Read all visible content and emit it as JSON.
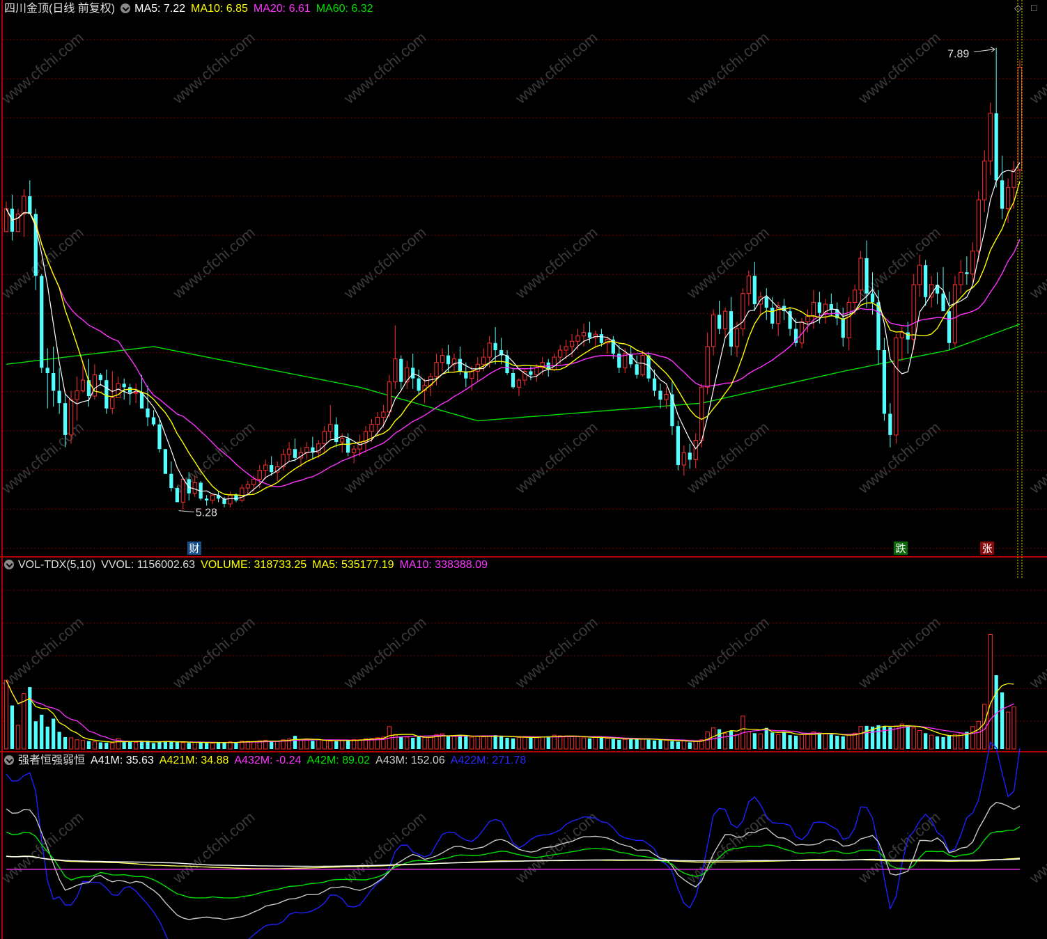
{
  "main_header": {
    "title": "四川金顶(日线 前复权)",
    "ma5": "MA5: 7.22",
    "ma10": "MA10: 6.85",
    "ma20": "MA20: 6.61",
    "ma60": "MA60: 6.32"
  },
  "vol_header": {
    "name": "VOL-TDX(5,10)",
    "vvol": "VVOL: 1156002.63",
    "volume": "VOLUME: 318733.25",
    "ma5": "MA5: 535177.19",
    "ma10": "MA10: 338388.09"
  },
  "ind_header": {
    "name": "强者恒强弱恒",
    "a41m": "A41M: 35.63",
    "a421m": "A421M: 34.88",
    "a432m": "A432M: -0.24",
    "a42m": "A42M: 89.02",
    "a43m": "A43M: 152.06",
    "a422m": "A422M: 271.78"
  },
  "annotations": {
    "high": "7.89",
    "low": "5.28",
    "cai": "财",
    "die": "跌",
    "zhang": "张"
  },
  "colors": {
    "up": "#ff3030",
    "down": "#54ffff",
    "ma5": "#ffffff",
    "ma10": "#ffff00",
    "ma20": "#ff33ff",
    "ma60": "#00e000",
    "grid": "#7a0000",
    "a422m": "#2020ff",
    "a43m": "#c8c8c8",
    "a42m": "#00e000",
    "a421m": "#ffff66",
    "a41m": "#ffffff",
    "a432m": "#ff33ff"
  },
  "watermark": "www.cfchi.com",
  "chart_data": [
    {
      "type": "candlestick",
      "title": "四川金顶(日线 前复权)",
      "ylim": [
        5.05,
        8.05
      ],
      "max_price": 7.89,
      "min_price": 5.28,
      "ohlc": [
        [
          6.85,
          7.02,
          6.85,
          6.98
        ],
        [
          6.98,
          7.06,
          6.8,
          6.85
        ],
        [
          6.85,
          6.98,
          6.85,
          6.95
        ],
        [
          6.95,
          7.09,
          6.82,
          7.05
        ],
        [
          7.05,
          7.14,
          6.95,
          6.95
        ],
        [
          6.95,
          6.98,
          6.52,
          6.6
        ],
        [
          6.6,
          6.61,
          6.05,
          6.08
        ],
        [
          6.08,
          6.19,
          5.85,
          6.05
        ],
        [
          6.05,
          6.2,
          5.86,
          5.95
        ],
        [
          5.95,
          6.08,
          5.82,
          5.88
        ],
        [
          5.88,
          5.93,
          5.63,
          5.7
        ],
        [
          5.7,
          5.95,
          5.65,
          5.9
        ],
        [
          5.9,
          6.03,
          5.78,
          5.95
        ],
        [
          5.95,
          6.12,
          5.94,
          6.01
        ],
        [
          6.01,
          6.13,
          5.86,
          5.92
        ],
        [
          5.92,
          6.1,
          5.9,
          6.04
        ],
        [
          6.04,
          6.05,
          5.98,
          6.01
        ],
        [
          6.01,
          6.07,
          5.82,
          5.85
        ],
        [
          5.85,
          6.06,
          5.82,
          5.91
        ],
        [
          5.91,
          6.03,
          5.94,
          5.99
        ],
        [
          5.99,
          6.02,
          5.9,
          5.97
        ],
        [
          5.97,
          5.99,
          5.87,
          5.94
        ],
        [
          5.94,
          5.99,
          5.88,
          5.94
        ],
        [
          5.94,
          6.04,
          5.85,
          5.85
        ],
        [
          5.85,
          5.98,
          5.75,
          5.8
        ],
        [
          5.8,
          5.84,
          5.75,
          5.76
        ],
        [
          5.76,
          5.79,
          5.6,
          5.62
        ],
        [
          5.62,
          5.61,
          5.5,
          5.48
        ],
        [
          5.48,
          5.55,
          5.38,
          5.4
        ],
        [
          5.4,
          5.41,
          5.32,
          5.32
        ],
        [
          5.32,
          5.46,
          5.28,
          5.45
        ],
        [
          5.45,
          5.49,
          5.33,
          5.37
        ],
        [
          5.37,
          5.47,
          5.35,
          5.43
        ],
        [
          5.43,
          5.44,
          5.33,
          5.34
        ],
        [
          5.34,
          5.36,
          5.3,
          5.33
        ],
        [
          5.33,
          5.36,
          5.31,
          5.36
        ],
        [
          5.36,
          5.38,
          5.32,
          5.34
        ],
        [
          5.34,
          5.35,
          5.29,
          5.31
        ],
        [
          5.31,
          5.38,
          5.29,
          5.36
        ],
        [
          5.36,
          5.37,
          5.32,
          5.33
        ],
        [
          5.33,
          5.42,
          5.32,
          5.4
        ],
        [
          5.4,
          5.44,
          5.36,
          5.42
        ],
        [
          5.42,
          5.47,
          5.38,
          5.45
        ],
        [
          5.45,
          5.53,
          5.4,
          5.5
        ],
        [
          5.5,
          5.56,
          5.45,
          5.53
        ],
        [
          5.53,
          5.58,
          5.47,
          5.49
        ],
        [
          5.49,
          5.55,
          5.44,
          5.52
        ],
        [
          5.52,
          5.62,
          5.5,
          5.59
        ],
        [
          5.59,
          5.66,
          5.55,
          5.62
        ],
        [
          5.62,
          5.68,
          5.55,
          5.57
        ],
        [
          5.57,
          5.63,
          5.52,
          5.6
        ],
        [
          5.6,
          5.66,
          5.56,
          5.63
        ],
        [
          5.63,
          5.69,
          5.56,
          5.6
        ],
        [
          5.6,
          5.67,
          5.57,
          5.65
        ],
        [
          5.65,
          5.75,
          5.6,
          5.72
        ],
        [
          5.72,
          5.87,
          5.68,
          5.76
        ],
        [
          5.76,
          5.8,
          5.63,
          5.66
        ],
        [
          5.66,
          5.71,
          5.6,
          5.68
        ],
        [
          5.68,
          5.71,
          5.58,
          5.6
        ],
        [
          5.6,
          5.64,
          5.54,
          5.62
        ],
        [
          5.62,
          5.7,
          5.58,
          5.66
        ],
        [
          5.66,
          5.75,
          5.6,
          5.72
        ],
        [
          5.72,
          5.79,
          5.66,
          5.76
        ],
        [
          5.76,
          5.83,
          5.7,
          5.8
        ],
        [
          5.8,
          5.87,
          5.74,
          5.83
        ],
        [
          5.83,
          6.04,
          5.8,
          6.0
        ],
        [
          6.0,
          6.32,
          5.96,
          6.13
        ],
        [
          6.13,
          6.15,
          5.96,
          6.0
        ],
        [
          6.0,
          6.12,
          5.96,
          6.08
        ],
        [
          6.08,
          6.16,
          5.96,
          6.02
        ],
        [
          6.02,
          6.07,
          5.93,
          5.95
        ],
        [
          5.95,
          6.02,
          5.88,
          5.98
        ],
        [
          5.98,
          6.05,
          5.92,
          6.03
        ],
        [
          6.03,
          6.16,
          5.98,
          6.11
        ],
        [
          6.11,
          6.19,
          6.06,
          6.15
        ],
        [
          6.15,
          6.21,
          6.05,
          6.1
        ],
        [
          6.1,
          6.16,
          6.06,
          6.13
        ],
        [
          6.13,
          6.2,
          6.04,
          6.06
        ],
        [
          6.06,
          6.11,
          5.97,
          6.02
        ],
        [
          6.02,
          6.09,
          5.95,
          6.06
        ],
        [
          6.06,
          6.14,
          6.0,
          6.1
        ],
        [
          6.1,
          6.19,
          6.06,
          6.14
        ],
        [
          6.14,
          6.26,
          6.08,
          6.22
        ],
        [
          6.22,
          6.31,
          6.1,
          6.18
        ],
        [
          6.18,
          6.25,
          6.1,
          6.15
        ],
        [
          6.15,
          6.18,
          6.04,
          6.05
        ],
        [
          6.05,
          6.08,
          5.96,
          5.97
        ],
        [
          5.97,
          6.02,
          5.92,
          6.01
        ],
        [
          6.01,
          6.07,
          5.98,
          6.06
        ],
        [
          6.06,
          6.09,
          6.01,
          6.04
        ],
        [
          6.04,
          6.1,
          6.0,
          6.08
        ],
        [
          6.08,
          6.14,
          6.04,
          6.11
        ],
        [
          6.11,
          6.13,
          6.03,
          6.07
        ],
        [
          6.07,
          6.16,
          6.06,
          6.14
        ],
        [
          6.14,
          6.21,
          6.1,
          6.18
        ],
        [
          6.18,
          6.24,
          6.13,
          6.2
        ],
        [
          6.2,
          6.27,
          6.14,
          6.23
        ],
        [
          6.23,
          6.3,
          6.18,
          6.26
        ],
        [
          6.26,
          6.33,
          6.2,
          6.28
        ],
        [
          6.28,
          6.34,
          6.22,
          6.25
        ],
        [
          6.25,
          6.29,
          6.19,
          6.27
        ],
        [
          6.27,
          6.3,
          6.2,
          6.22
        ],
        [
          6.22,
          6.26,
          6.16,
          6.24
        ],
        [
          6.24,
          6.26,
          6.13,
          6.16
        ],
        [
          6.16,
          6.21,
          6.05,
          6.08
        ],
        [
          6.08,
          6.19,
          6.05,
          6.16
        ],
        [
          6.16,
          6.2,
          6.08,
          6.1
        ],
        [
          6.1,
          6.15,
          6.02,
          6.04
        ],
        [
          6.04,
          6.18,
          6.03,
          6.15
        ],
        [
          6.15,
          6.17,
          6.0,
          6.02
        ],
        [
          6.02,
          6.07,
          5.92,
          5.95
        ],
        [
          5.95,
          5.99,
          5.85,
          5.9
        ],
        [
          5.9,
          5.97,
          5.85,
          5.93
        ],
        [
          5.93,
          6.0,
          5.7,
          5.75
        ],
        [
          5.75,
          5.78,
          5.5,
          5.53
        ],
        [
          5.53,
          5.64,
          5.47,
          5.6
        ],
        [
          5.6,
          5.65,
          5.51,
          5.56
        ],
        [
          5.56,
          5.71,
          5.51,
          5.67
        ],
        [
          5.67,
          5.99,
          5.63,
          5.97
        ],
        [
          5.97,
          6.28,
          5.93,
          6.2
        ],
        [
          6.2,
          6.41,
          6.15,
          6.38
        ],
        [
          6.38,
          6.46,
          6.27,
          6.3
        ],
        [
          6.3,
          6.42,
          6.25,
          6.4
        ],
        [
          6.4,
          6.48,
          6.15,
          6.2
        ],
        [
          6.2,
          6.34,
          6.14,
          6.3
        ],
        [
          6.3,
          6.53,
          6.26,
          6.5
        ],
        [
          6.5,
          6.63,
          6.43,
          6.6
        ],
        [
          6.6,
          6.68,
          6.4,
          6.44
        ],
        [
          6.44,
          6.51,
          6.38,
          6.48
        ],
        [
          6.48,
          6.53,
          6.35,
          6.42
        ],
        [
          6.42,
          6.48,
          6.3,
          6.33
        ],
        [
          6.33,
          6.45,
          6.26,
          6.43
        ],
        [
          6.43,
          6.47,
          6.35,
          6.4
        ],
        [
          6.4,
          6.42,
          6.26,
          6.3
        ],
        [
          6.3,
          6.36,
          6.2,
          6.22
        ],
        [
          6.22,
          6.36,
          6.19,
          6.34
        ],
        [
          6.34,
          6.41,
          6.28,
          6.37
        ],
        [
          6.37,
          6.52,
          6.3,
          6.45
        ],
        [
          6.45,
          6.51,
          6.33,
          6.39
        ],
        [
          6.39,
          6.47,
          6.33,
          6.44
        ],
        [
          6.44,
          6.5,
          6.37,
          6.41
        ],
        [
          6.41,
          6.45,
          6.32,
          6.36
        ],
        [
          6.36,
          6.42,
          6.2,
          6.25
        ],
        [
          6.25,
          6.48,
          6.18,
          6.45
        ],
        [
          6.45,
          6.55,
          6.38,
          6.52
        ],
        [
          6.52,
          6.74,
          6.46,
          6.7
        ],
        [
          6.7,
          6.8,
          6.42,
          6.5
        ],
        [
          6.5,
          6.62,
          6.38,
          6.45
        ],
        [
          6.45,
          6.52,
          6.1,
          6.18
        ],
        [
          6.18,
          6.25,
          5.78,
          5.82
        ],
        [
          5.82,
          5.88,
          5.63,
          5.7
        ],
        [
          5.7,
          6.27,
          5.65,
          6.25
        ],
        [
          6.25,
          6.31,
          6.12,
          6.28
        ],
        [
          6.28,
          6.34,
          6.16,
          6.24
        ],
        [
          6.24,
          6.61,
          6.18,
          6.55
        ],
        [
          6.55,
          6.72,
          6.48,
          6.66
        ],
        [
          6.66,
          6.69,
          6.43,
          6.48
        ],
        [
          6.48,
          6.6,
          6.42,
          6.55
        ],
        [
          6.55,
          6.62,
          6.44,
          6.5
        ],
        [
          6.5,
          6.65,
          6.45,
          6.4
        ],
        [
          6.4,
          6.51,
          6.18,
          6.22
        ],
        [
          6.22,
          6.6,
          6.2,
          6.55
        ],
        [
          6.55,
          6.69,
          6.5,
          6.62
        ],
        [
          6.62,
          6.71,
          6.55,
          6.61
        ],
        [
          6.61,
          6.79,
          6.56,
          6.74
        ],
        [
          6.74,
          7.08,
          6.68,
          7.03
        ],
        [
          7.03,
          7.31,
          6.96,
          7.25
        ],
        [
          7.25,
          7.58,
          7.17,
          7.52
        ],
        [
          7.52,
          7.89,
          7.1,
          7.14
        ],
        [
          7.14,
          7.28,
          6.92,
          6.98
        ],
        [
          6.98,
          7.15,
          6.9,
          7.1
        ],
        [
          7.1,
          7.25,
          6.98,
          7.2
        ],
        [
          7.2,
          7.82,
          7.15,
          7.78
        ]
      ],
      "series": [
        {
          "name": "MA5"
        },
        {
          "name": "MA10"
        },
        {
          "name": "MA20"
        },
        {
          "name": "MA60"
        }
      ]
    },
    {
      "type": "bar",
      "title": "VOL-TDX(5,10)",
      "ylim": [
        0,
        1300000
      ],
      "volume": [
        520000,
        330000,
        180000,
        420000,
        470000,
        210000,
        260000,
        170000,
        230000,
        130000,
        90000,
        85000,
        70000,
        65000,
        60000,
        55000,
        50000,
        48000,
        45000,
        80000,
        52000,
        58000,
        50000,
        55000,
        62000,
        45000,
        58000,
        60000,
        55000,
        50000,
        48000,
        46000,
        52000,
        54000,
        45000,
        44000,
        50000,
        48000,
        55000,
        52000,
        60000,
        58000,
        55000,
        62000,
        65000,
        60000,
        58000,
        70000,
        75000,
        100000,
        65000,
        68000,
        62000,
        70000,
        66000,
        60000,
        58000,
        65000,
        70000,
        72000,
        70000,
        78000,
        80000,
        85000,
        90000,
        170000,
        110000,
        95000,
        90000,
        85000,
        92000,
        88000,
        90000,
        110000,
        115000,
        100000,
        96000,
        105000,
        98000,
        90000,
        95000,
        92000,
        100000,
        105000,
        98000,
        85000,
        80000,
        88000,
        95000,
        90000,
        86000,
        92000,
        96000,
        105000,
        100000,
        98000,
        92000,
        95000,
        85000,
        80000,
        90000,
        88000,
        80000,
        76000,
        70000,
        72000,
        82000,
        78000,
        74000,
        70000,
        65000,
        68000,
        66000,
        60000,
        55000,
        62000,
        50000,
        58000,
        70000,
        130000,
        160000,
        150000,
        120000,
        140000,
        110000,
        250000,
        130000,
        120000,
        115000,
        160000,
        125000,
        110000,
        130000,
        105000,
        100000,
        110000,
        115000,
        130000,
        120000,
        115000,
        110000,
        100000,
        95000,
        105000,
        120000,
        170000,
        175000,
        170000,
        180000,
        170000,
        165000,
        175000,
        190000,
        180000,
        160000,
        140000,
        120000,
        105000,
        95000,
        90000,
        100000,
        110000,
        120000,
        130000,
        170000,
        210000,
        340000,
        870000,
        560000,
        430000,
        280000,
        318733
      ]
    },
    {
      "type": "line",
      "title": "强者恒强弱恒",
      "series": [
        {
          "name": "A422M"
        },
        {
          "name": "A43M"
        },
        {
          "name": "A42M"
        },
        {
          "name": "A421M"
        },
        {
          "name": "A41M"
        },
        {
          "name": "A432M"
        }
      ]
    }
  ]
}
